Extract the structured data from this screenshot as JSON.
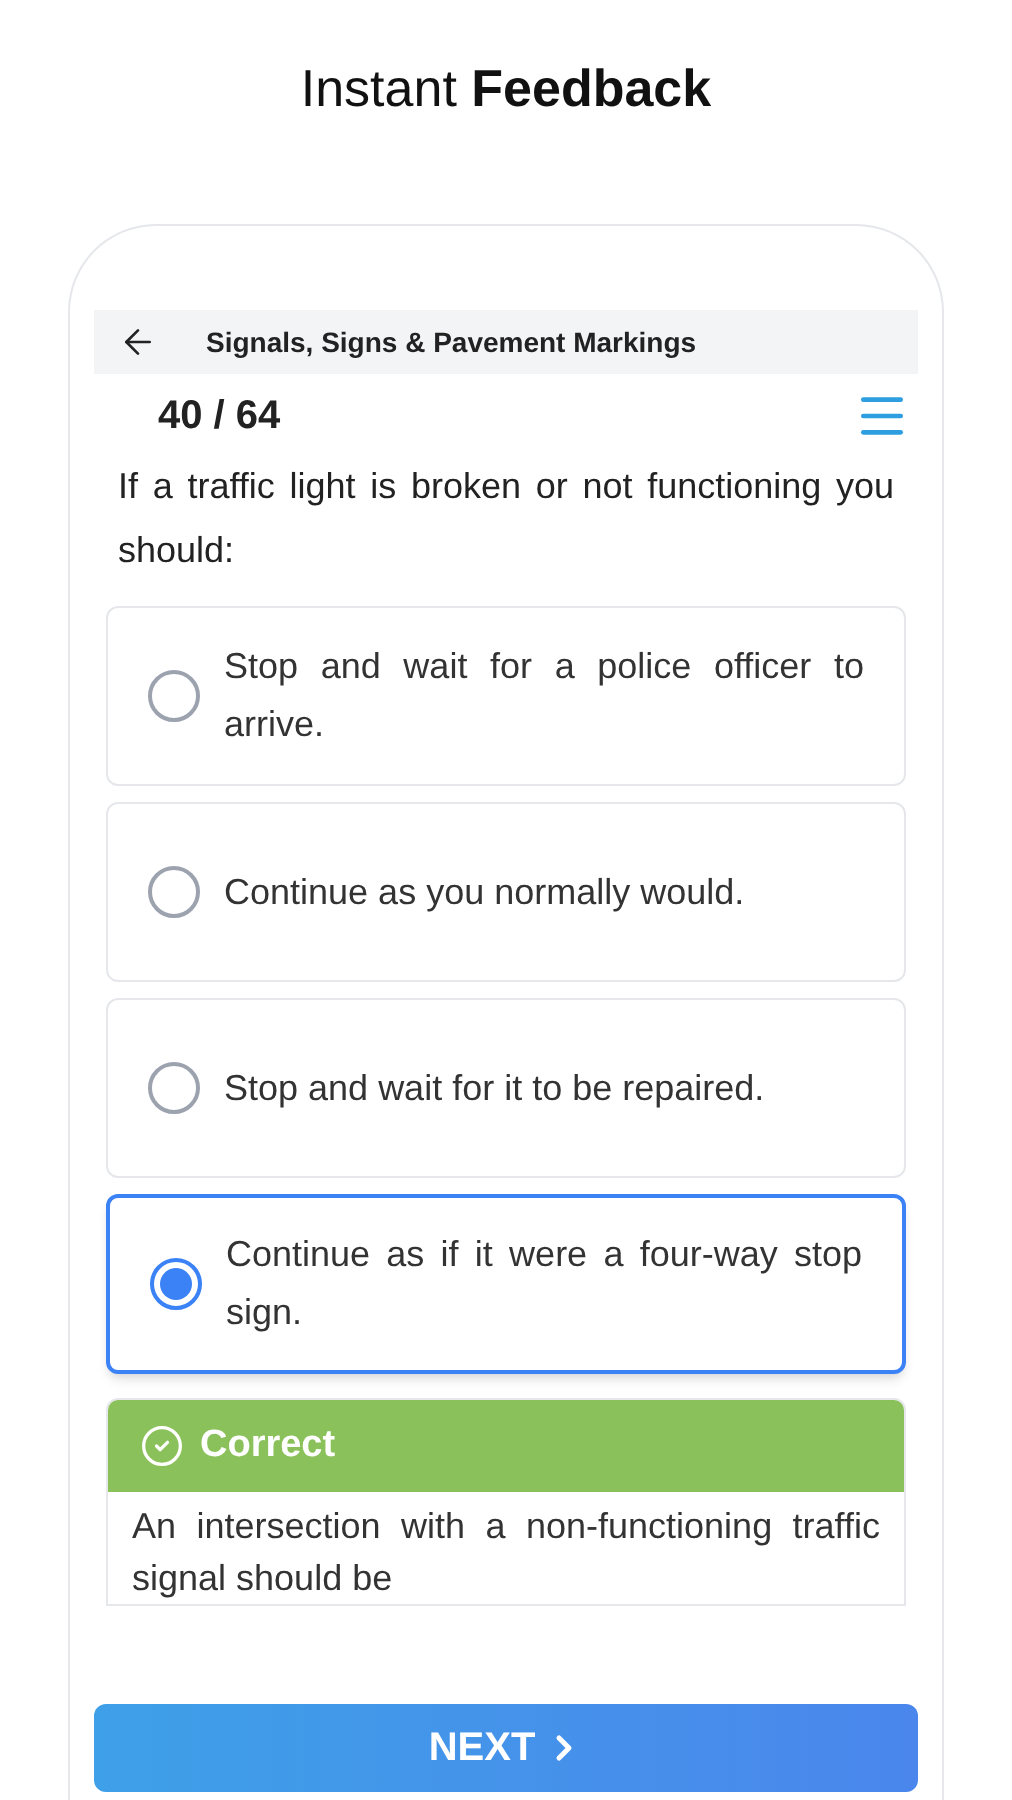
{
  "headline": "Instant **Feedback**",
  "header": {
    "title": "Signals, Signs & Pavement Markings"
  },
  "counter": "40 / 64",
  "question": "If a traffic light is broken or not functioning you should:",
  "options": [
    {
      "text": "Stop and wait for a police officer to arrive.",
      "selected": false
    },
    {
      "text": "Continue as you normally would.",
      "selected": false
    },
    {
      "text": "Stop and wait for it to be repaired.",
      "selected": false
    },
    {
      "text": "Continue as if it were a four-way stop sign.",
      "selected": true
    }
  ],
  "feedback": {
    "kind": "correct",
    "label": "Correct",
    "explanation": "An intersection with a non-functioning traffic signal should be"
  },
  "next_button": "NEXT"
}
